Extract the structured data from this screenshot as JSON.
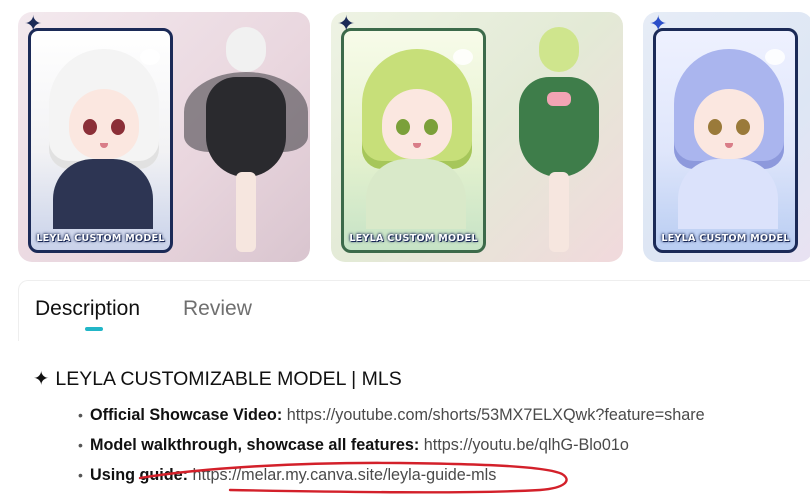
{
  "gallery": {
    "cards": [
      {
        "label": "LEYLA CUSTOM MODEL"
      },
      {
        "label": "LEYLA CUSTOM MODEL"
      },
      {
        "label": "LEYLA CUSTOM MODEL"
      }
    ]
  },
  "tabs": [
    {
      "label": "Description",
      "active": true
    },
    {
      "label": "Review",
      "active": false
    }
  ],
  "description": {
    "title_star": "✦",
    "title": "LEYLA CUSTOMIZABLE MODEL | MLS",
    "links": [
      {
        "label": "Official Showcase Video:",
        "url": "https://youtube.com/shorts/53MX7ELXQwk?feature=share"
      },
      {
        "label": "Model walkthrough, showcase all features:",
        "url": "https://youtu.be/qlhG-Blo01o"
      },
      {
        "label": "Using guide:",
        "url": "https://melar.my.canva.site/leyla-guide-mls"
      }
    ]
  },
  "colors": {
    "accent": "#22b6c7",
    "annotation_red": "#d3202a",
    "frame_navy": "#1b2a57"
  }
}
